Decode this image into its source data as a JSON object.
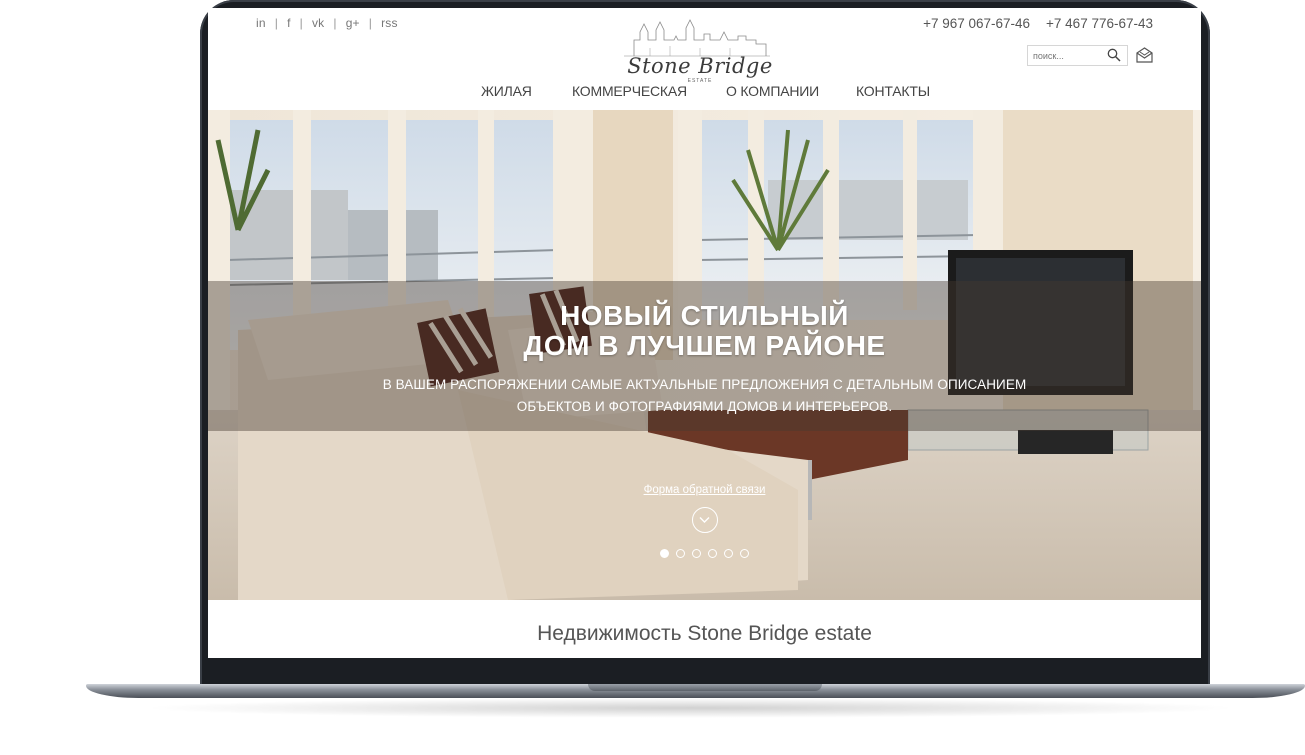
{
  "social": [
    "in",
    "f",
    "vk",
    "g+",
    "rss"
  ],
  "phones": [
    "+7 967 067-67-46",
    "+7 467 776-67-43"
  ],
  "logo": {
    "name": "Stone Bridge",
    "sub": "ESTATE"
  },
  "search": {
    "placeholder": "поиск..."
  },
  "nav": [
    "ЖИЛАЯ",
    "КОММЕРЧЕСКАЯ",
    "О КОМПАНИИ",
    "КОНТАКТЫ"
  ],
  "hero": {
    "title_line1": "НОВЫЙ СТИЛЬНЫЙ",
    "title_line2": "ДОМ В ЛУЧШЕМ РАЙОНЕ",
    "subtitle_line1": "В ВАШЕМ РАСПОРЯЖЕНИИ САМЫЕ АКТУАЛЬНЫЕ ПРЕДЛОЖЕНИЯ С ДЕТАЛЬНЫМ ОПИСАНИЕМ",
    "subtitle_line2": "ОБЪЕКТОВ И  ФОТОГРАФИЯМИ ДОМОВ И ИНТЕРЬЕРОВ.",
    "feedback_link": "Форма обратной связи",
    "slides_total": 6,
    "active_slide": 1
  },
  "section_title": "Недвижимость Stone Bridge estate",
  "icons": [
    "search-icon",
    "mail-icon",
    "chevron-down-icon"
  ],
  "colors": {
    "frame": "#1b1e23",
    "text": "#444444",
    "overlay": "#463a30"
  }
}
